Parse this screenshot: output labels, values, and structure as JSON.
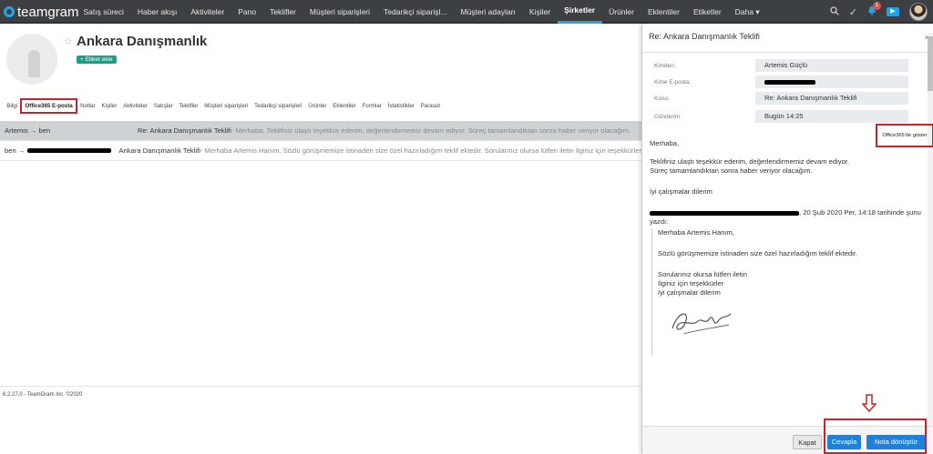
{
  "app": {
    "brand": "teamgram"
  },
  "nav": {
    "items": [
      {
        "label": "Satış süreci"
      },
      {
        "label": "Haber akışı"
      },
      {
        "label": "Aktiviteler"
      },
      {
        "label": "Pano"
      },
      {
        "label": "Teklifler"
      },
      {
        "label": "Müşteri siparişleri"
      },
      {
        "label": "Tedarikçi siparişl..."
      },
      {
        "label": "Müşteri adayları"
      },
      {
        "label": "Kişiler"
      },
      {
        "label": "Şirketler",
        "active": true
      },
      {
        "label": "Ürünler"
      },
      {
        "label": "Eklentiler"
      },
      {
        "label": "Etiketler"
      },
      {
        "label": "Daha ▾"
      }
    ],
    "notification_count": "1"
  },
  "company": {
    "name": "Ankara Danışmanlık",
    "add_tag_label": "+ Etiket ekle"
  },
  "tabs": [
    {
      "label": "Bilgi"
    },
    {
      "label": "Office365 E-posta",
      "active": true
    },
    {
      "label": "Notlar"
    },
    {
      "label": "Kişiler"
    },
    {
      "label": "Aktiviteler"
    },
    {
      "label": "Satışlar"
    },
    {
      "label": "Teklifler"
    },
    {
      "label": "Müşteri siparişleri"
    },
    {
      "label": "Tedarikçi siparişleri"
    },
    {
      "label": "Ürünler"
    },
    {
      "label": "Eklentiler"
    },
    {
      "label": "Formlar"
    },
    {
      "label": "İstatistikler"
    },
    {
      "label": "Parasut"
    }
  ],
  "emails": [
    {
      "from": "Artemis → ben",
      "subject": "Re: Ankara Danışmanlık Teklifi",
      "snippet": " - Merhaba, Teklifiniz ulaştı teşekkür ederim, değerlendirmemiz devam ediyor. Süreç tamamlandıktan sonra haber veriyor olacağım.",
      "selected": true
    },
    {
      "from": "ben →",
      "subject": "Ankara Danışmanlık Teklifi",
      "snippet": " - Merhaba Artemis Hanım, Sözlü görüşmemize istinaden size özel hazırladığım teklif ektedir. Sorularınız olursa lütfen iletin İlginiz için teşekkürler",
      "selected": false
    }
  ],
  "footer": {
    "text": "6.2.27.0 - TeamGram Inc. ©2020"
  },
  "panel": {
    "title": "Re: Ankara Danışmanlık Teklifi",
    "close": "×",
    "fields": [
      {
        "label": "Kimden:",
        "value": "Artemis Güçlü"
      },
      {
        "label": "Kime E-posta:",
        "value": ""
      },
      {
        "label": "Konu:",
        "value": "Re: Ankara Danışmanlık Teklifi"
      },
      {
        "label": "Gönderim:",
        "value": "Bugün 14:25"
      }
    ],
    "show_in_office": "Office365'de göster",
    "body": {
      "greeting": "Merhaba,",
      "line1": "Teklifiniz ulaştı teşekkür ederim, değerlendirmemiz devam ediyor.",
      "line2": "Süreç tamamlandıktan sonra haber veriyor olacağım.",
      "closing": "İyi çalışmalar dilerim",
      "quote_header": ", 20 Şub 2020 Per, 14:18 tarihinde şunu",
      "quote_header2": "yazdı:"
    },
    "quote": {
      "l1": "Merhaba Artemis Hanım,",
      "l2": "Sözlü görüşmemize istinaden size özel hazırladığım teklif ektedir.",
      "l3": "Sorularınız olursa lütfen iletin",
      "l4": "İlginiz için teşekkürler",
      "l5": "İyi çalışmalar dilerim"
    },
    "buttons": {
      "close": "Kapat",
      "reply": "Cevapla",
      "to_note": "Nota dönüştür"
    }
  }
}
